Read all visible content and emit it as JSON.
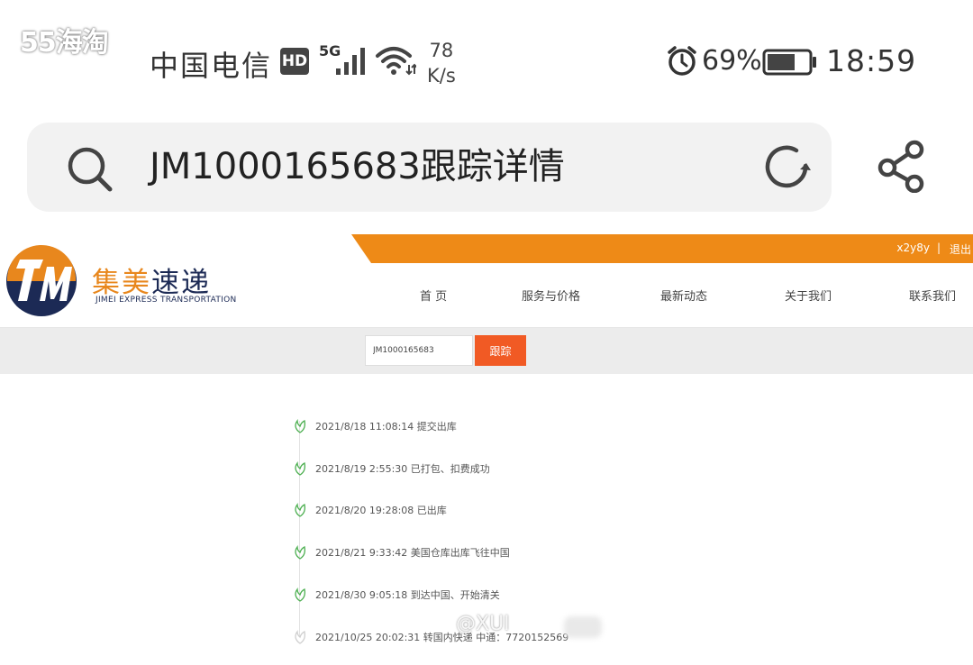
{
  "watermark": {
    "top": "55海淘",
    "bottom": "@XUI"
  },
  "status_bar": {
    "carrier": "中国电信",
    "hd": "HD",
    "network": "5G",
    "speed_value": "78",
    "speed_unit": "K/s",
    "battery_percent": "69%",
    "battery_level": 0.69,
    "time": "18:59"
  },
  "browser": {
    "address_text": "JM1000165683跟踪详情"
  },
  "site": {
    "brand_cn_part1": "集美",
    "brand_cn_part2": "速递",
    "brand_en": "JIMEI   EXPRESS TRANSPORTATION",
    "user": "x2y8y",
    "separator": "|",
    "logout": "退出",
    "nav": [
      "首 页",
      "服务与价格",
      "最新动态",
      "关于我们",
      "联系我们"
    ],
    "tracking_input": "JM1000165683",
    "track_button": "跟踪",
    "colors": {
      "accent_orange": "#ee8a17",
      "button_red": "#f15a24",
      "logo_navy": "#1c2a55",
      "timeline_green": "#4caf50"
    }
  },
  "events": [
    "2021/8/18 11:08:14 提交出库",
    "2021/8/19 2:55:30 已打包、扣费成功",
    "2021/8/20 19:28:08 已出库",
    "2021/8/21 9:33:42 美国仓库出库飞往中国",
    "2021/8/30 9:05:18 到达中国、开始清关",
    "2021/10/25 20:02:31 转国内快递 中通：7720152569"
  ],
  "icons": [
    "search-icon",
    "refresh-icon",
    "share-icon",
    "alarm-icon",
    "battery-icon",
    "signal-icon",
    "wifi-icon",
    "leaf-icon"
  ]
}
